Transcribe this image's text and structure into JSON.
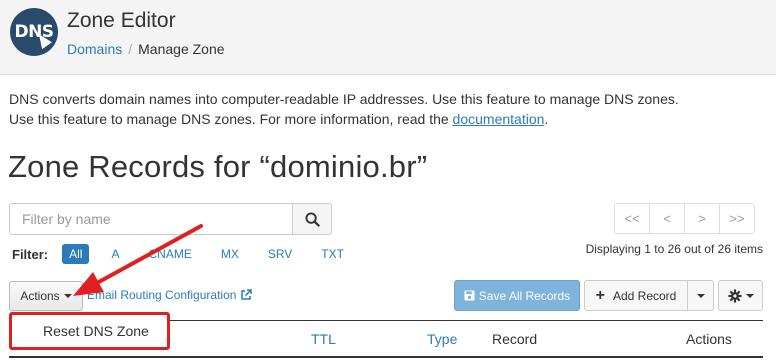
{
  "header": {
    "logo_text": "DNS",
    "title": "Zone Editor",
    "breadcrumb": {
      "parent": "Domains",
      "separator": "/",
      "current": "Manage Zone"
    }
  },
  "description": {
    "line1": "DNS converts domain names into computer-readable IP addresses. Use this feature to manage DNS zones.",
    "line2_prefix": "Use this feature to manage DNS zones. For more information, read the ",
    "link": "documentation",
    "line2_suffix": "."
  },
  "zone_title": "Zone Records for “dominio.br”",
  "search": {
    "placeholder": "Filter by name",
    "button_icon": "search-icon"
  },
  "pagination": {
    "first": "<<",
    "prev": "<",
    "next": ">",
    "last": ">>",
    "display_text": "Displaying 1 to 26 out of 26 items"
  },
  "filter": {
    "label": "Filter:",
    "options": [
      "All",
      "A",
      "CNAME",
      "MX",
      "SRV",
      "TXT"
    ],
    "selected": "All"
  },
  "toolbar": {
    "actions_label": "Actions",
    "email_routing_label": "Email Routing Configuration",
    "save_all_label": "Save All Records",
    "add_record_label": "Add Record"
  },
  "dropdown": {
    "items": [
      "Reset DNS Zone"
    ]
  },
  "table": {
    "columns": [
      "TTL",
      "Type",
      "Record",
      "Actions"
    ]
  },
  "colors": {
    "link": "#2b7bb9",
    "annotation": "#e02020",
    "save_button": "#7fb3dc",
    "logo_bg": "#2a4a6b"
  }
}
